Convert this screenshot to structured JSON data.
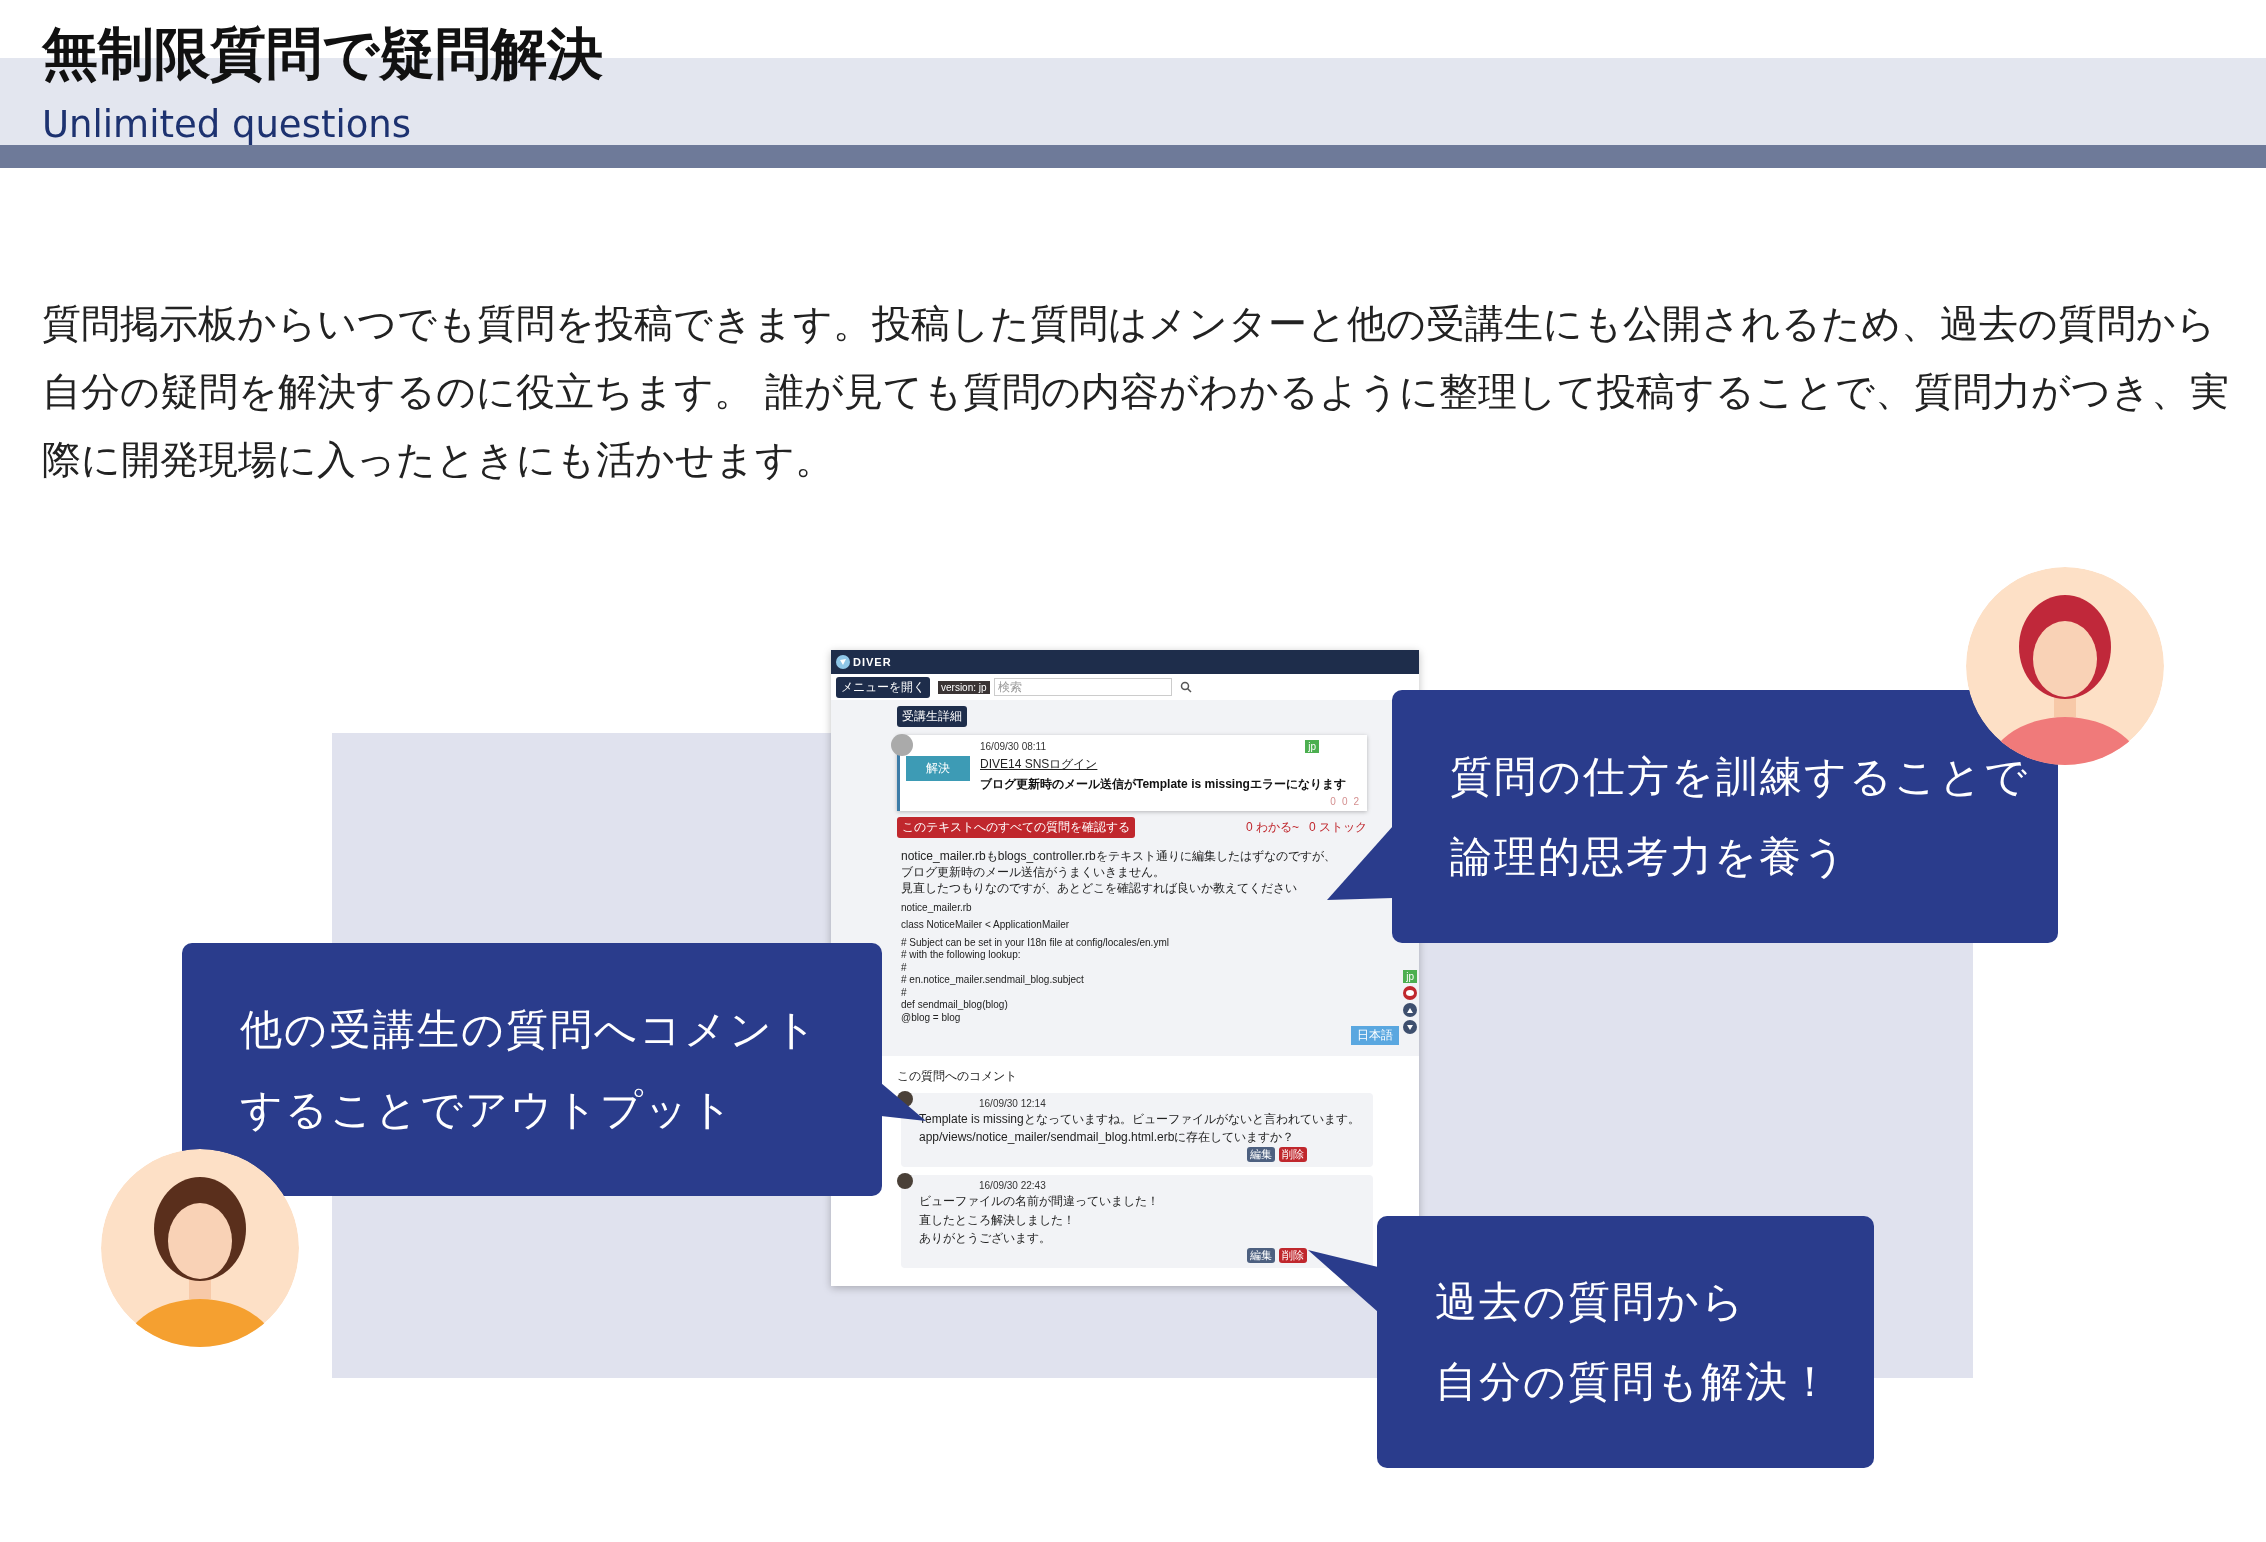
{
  "header": {
    "title": "無制限質問で疑問解決",
    "subtitle": "Unlimited questions"
  },
  "description": "質問掲示板からいつでも質問を投稿できます。投稿した質問はメンターと他の受講生にも公開されるため、過去の質問から自分の疑問を解決するのに役立ちます。 誰が見ても質問の内容がわかるように整理して投稿することで、質問力がつき、実際に開発現場に入ったときにも活かせます。",
  "callouts": [
    {
      "lines": [
        "質問の仕方を訓練することで",
        "論理的思考力を養う"
      ]
    },
    {
      "lines": [
        "他の受講生の質問へコメント",
        "することでアウトプット"
      ]
    },
    {
      "lines": [
        "過去の質問から",
        "自分の質問も解決！"
      ]
    }
  ],
  "app_screenshot": {
    "logo": "DIVER",
    "menu_button": "メニューを開く",
    "version_tag": "version: jp",
    "search": {
      "placeholder": "検索"
    },
    "detail_button": "受講生詳細",
    "question": {
      "date": "16/09/30 08:11",
      "status": "解決",
      "language": "jp",
      "text_link": "DIVE14 SNSログイン",
      "title": "ブログ更新時のメール送信がTemplate is missingエラーになります",
      "counts": [
        "0",
        "0",
        "2"
      ]
    },
    "all_questions_button": "このテキストへのすべての質問を確認する",
    "understood": "0 わかる~",
    "stock": "0 ストック",
    "body": [
      {
        "lines": [
          "notice_mailer.rbもblogs_controller.rbをテキスト通りに編集したはずなのですが、",
          "ブログ更新時のメール送信がうまくいきません。",
          "見直したつもりなのですが、あとどこを確認すれば良いか教えてください"
        ]
      },
      {
        "lines": [
          "notice_mailer.rb"
        ]
      },
      {
        "lines": [
          "class NoticeMailer < ApplicationMailer"
        ]
      },
      {
        "lines": [
          "# Subject can be set in your I18n file at config/locales/en.yml",
          "# with the following lookup:",
          "#",
          "# en.notice_mailer.sendmail_blog.subject",
          "#",
          "def sendmail_blog(blog)",
          "@blog = blog"
        ]
      }
    ],
    "side_language": "jp",
    "language_button": "日本語",
    "comments_heading": "この質問へのコメント",
    "comments": [
      {
        "date": "16/09/30 12:14",
        "lines": [
          "Template is missingとなっていますね。ビューファイルがないと言われています。",
          "app/views/notice_mailer/sendmail_blog.html.erbに存在していますか？"
        ],
        "edit": "編集",
        "delete": "削除"
      },
      {
        "date": "16/09/30 22:43",
        "lines": [
          "ビューファイルの名前が間違っていました！",
          "直したところ解決しました！",
          "ありがとうございます。"
        ],
        "edit": "編集",
        "delete": "削除"
      }
    ]
  }
}
